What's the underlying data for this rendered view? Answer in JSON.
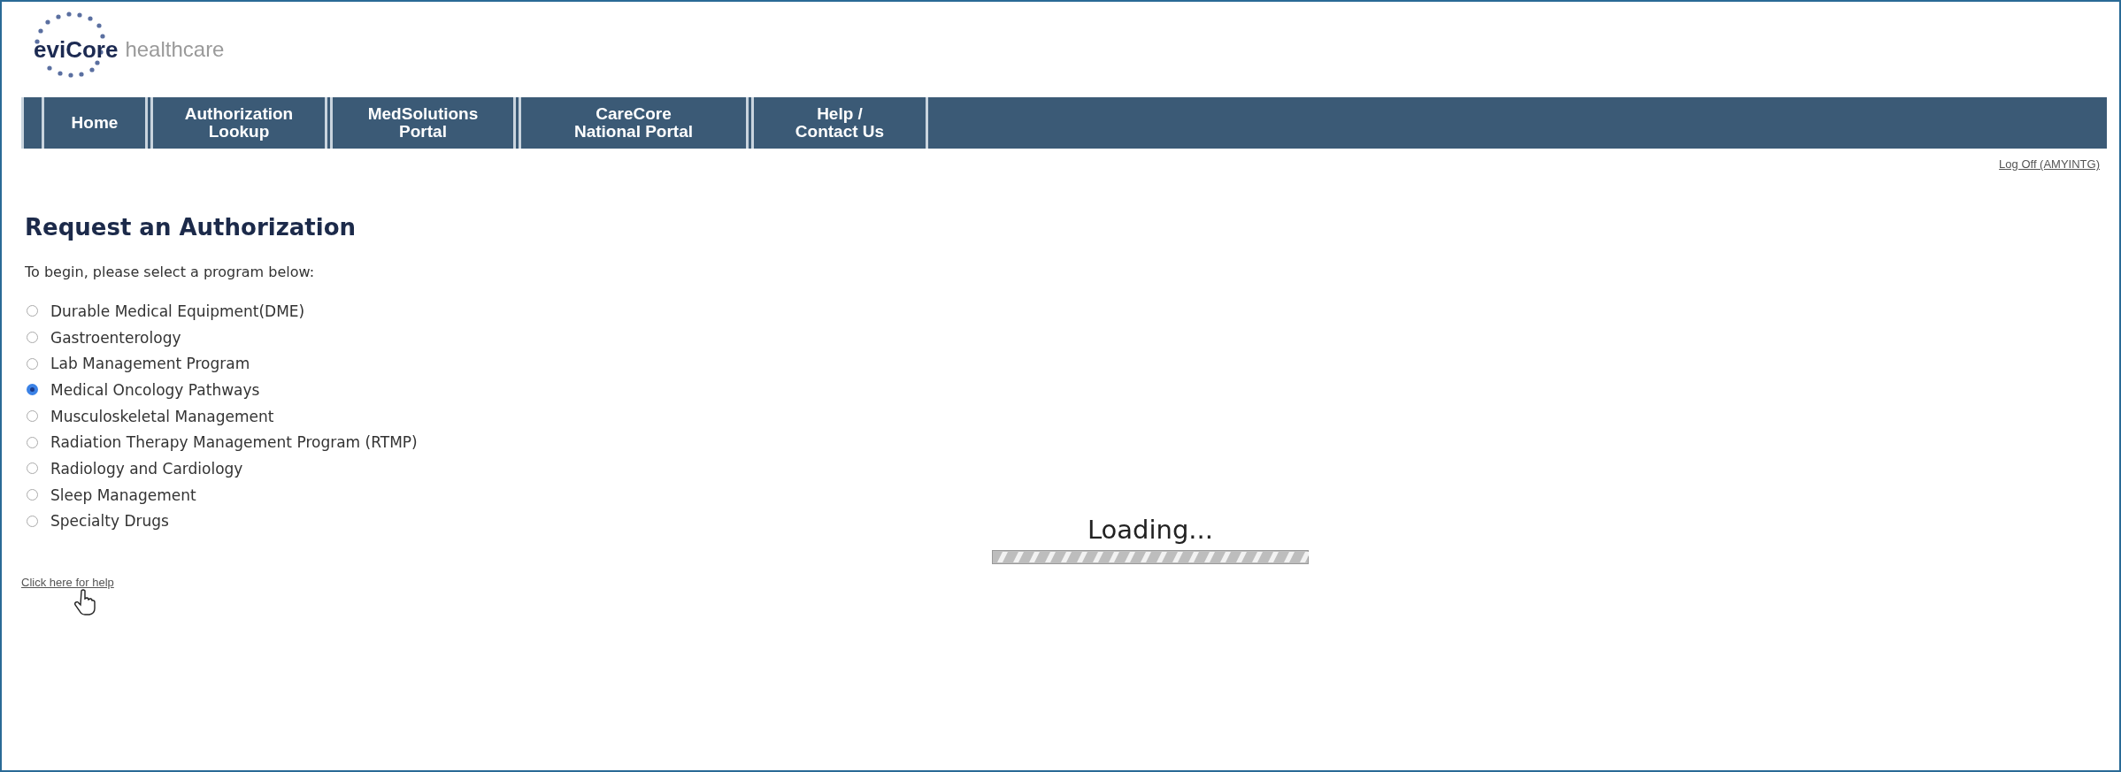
{
  "logo": {
    "brand": "eviCore",
    "suffix": "healthcare"
  },
  "nav": [
    {
      "label": "Home"
    },
    {
      "label": "Authorization Lookup"
    },
    {
      "label": "MedSolutions Portal"
    },
    {
      "label": "CareCore National Portal"
    },
    {
      "label": "Help / Contact Us"
    }
  ],
  "logoff": "Log Off (AMYINTG)",
  "title": "Request an Authorization",
  "intro": "To begin, please select a program below:",
  "programs": [
    {
      "label": "Durable Medical Equipment(DME)",
      "selected": false
    },
    {
      "label": "Gastroenterology",
      "selected": false
    },
    {
      "label": "Lab Management Program",
      "selected": false
    },
    {
      "label": "Medical Oncology Pathways",
      "selected": true
    },
    {
      "label": "Musculoskeletal Management",
      "selected": false
    },
    {
      "label": "Radiation Therapy Management Program (RTMP)",
      "selected": false
    },
    {
      "label": "Radiology and Cardiology",
      "selected": false
    },
    {
      "label": "Sleep Management",
      "selected": false
    },
    {
      "label": "Specialty Drugs",
      "selected": false
    }
  ],
  "help_link": "Click here for help",
  "loading": {
    "text": "Loading..."
  }
}
